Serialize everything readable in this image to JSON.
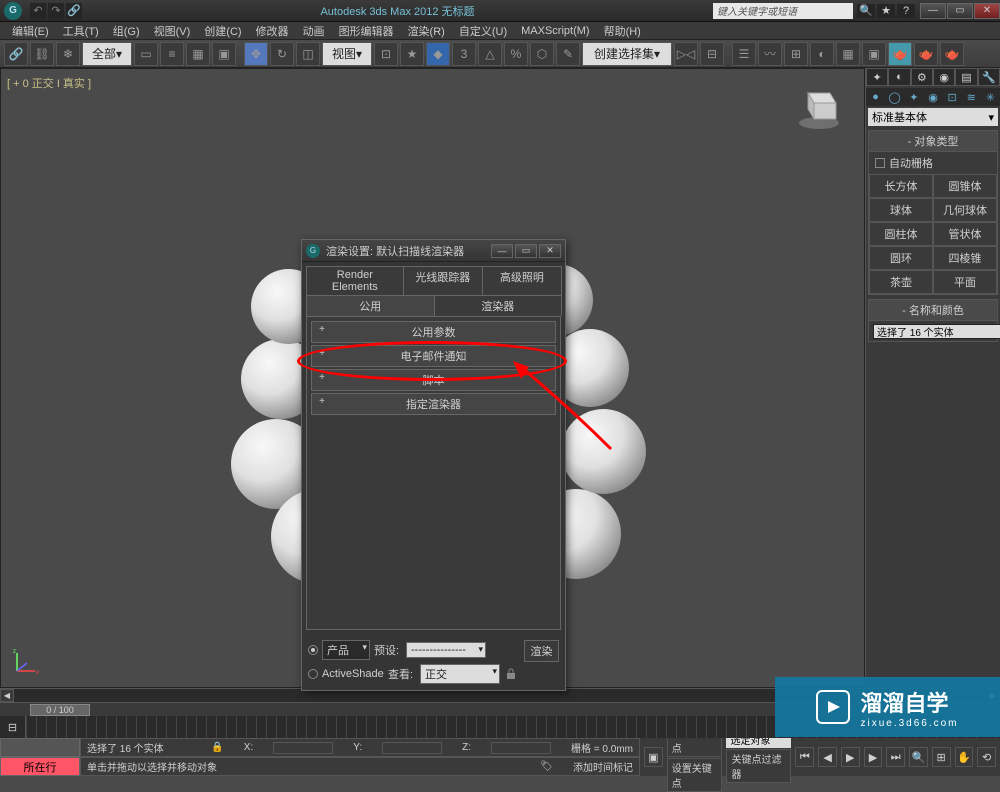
{
  "titlebar": {
    "app_logo": "G",
    "title": "Autodesk 3ds Max  2012        无标题",
    "search_placeholder": "键入关键字或短语"
  },
  "menu": [
    "编辑(E)",
    "工具(T)",
    "组(G)",
    "视图(V)",
    "创建(C)",
    "修改器",
    "动画",
    "图形编辑器",
    "渲染(R)",
    "自定义(U)",
    "MAXScript(M)",
    "帮助(H)"
  ],
  "toolbar": {
    "select_filter": "全部",
    "ref_coord": "视图",
    "named_sel": "创建选择集"
  },
  "viewport": {
    "label": "[ + 0  正交 I 真实  ]"
  },
  "rightpanel": {
    "dropdown": "标准基本体",
    "sec_objecttype": "对象类型",
    "autogrid": "自动栅格",
    "prims": [
      [
        "长方体",
        "圆锥体"
      ],
      [
        "球体",
        "几何球体"
      ],
      [
        "圆柱体",
        "管状体"
      ],
      [
        "圆环",
        "四棱锥"
      ],
      [
        "茶壶",
        "平面"
      ]
    ],
    "sec_namecolor": "名称和颜色",
    "name_value": "选择了 16 个实体"
  },
  "dialog": {
    "title": "渲染设置: 默认扫描线渲染器",
    "tabs_row1": [
      "Render Elements",
      "光线跟踪器",
      "高级照明"
    ],
    "tabs_row2": [
      "公用",
      "渲染器"
    ],
    "rollouts": [
      "公用参数",
      "电子邮件通知",
      "脚本",
      "指定渲染器"
    ],
    "product": "产品",
    "preset_label": "预设:",
    "preset_value": "---------------",
    "activeshade": "ActiveShade",
    "view_label": "查看:",
    "view_value": "正交",
    "render_button": "渲染"
  },
  "timeslider": {
    "pos": "0 / 100"
  },
  "status": {
    "row1_sel": "选择了 16 个实体",
    "row1_x": "X:",
    "row1_y": "Y:",
    "row1_z": "Z:",
    "row1_grid": "栅格 = 0.0mm",
    "row2_hint": "单击并拖动以选择并移动对象",
    "row2_addtime": "添加时间标记",
    "autokey": "自动关键点",
    "selset": "选定对象",
    "setkey": "设置关键点",
    "keyfilter": "关键点过滤器",
    "button_label": "所在行"
  },
  "watermark": {
    "main": "溜溜自学",
    "sub": "zixue.3d66.com"
  }
}
